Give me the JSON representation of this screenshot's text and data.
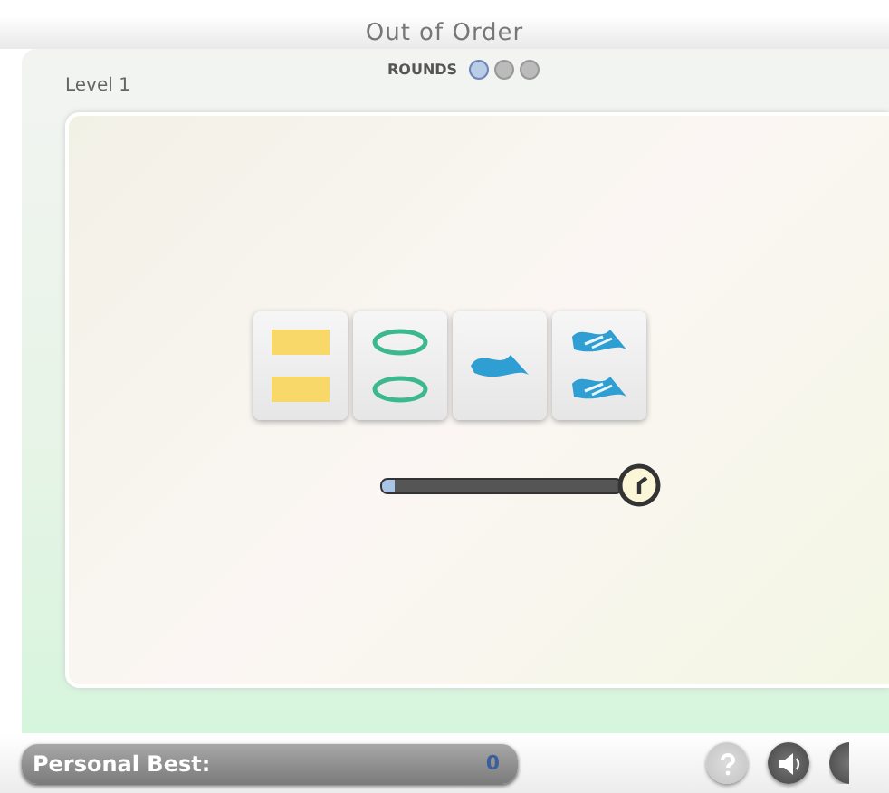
{
  "window": {
    "title": "Out of Order"
  },
  "level_label": "Level 1",
  "rounds": {
    "label": "ROUNDS",
    "items": [
      {
        "selected": true
      },
      {
        "selected": false
      },
      {
        "selected": false
      }
    ]
  },
  "cards": [
    {
      "kind": "rectangle",
      "double": true,
      "color": "#f9d86a"
    },
    {
      "kind": "oval",
      "double": true,
      "color": "#3bb88e"
    },
    {
      "kind": "squiggle",
      "double": false,
      "color": "#2f9fd3"
    },
    {
      "kind": "striped-squiggle",
      "double": true,
      "color": "#2f9fd3"
    }
  ],
  "timer": {
    "level": 0.06
  },
  "footer": {
    "personal_best_label": "Personal Best:",
    "personal_best_value": "0",
    "help_disabled": true
  }
}
